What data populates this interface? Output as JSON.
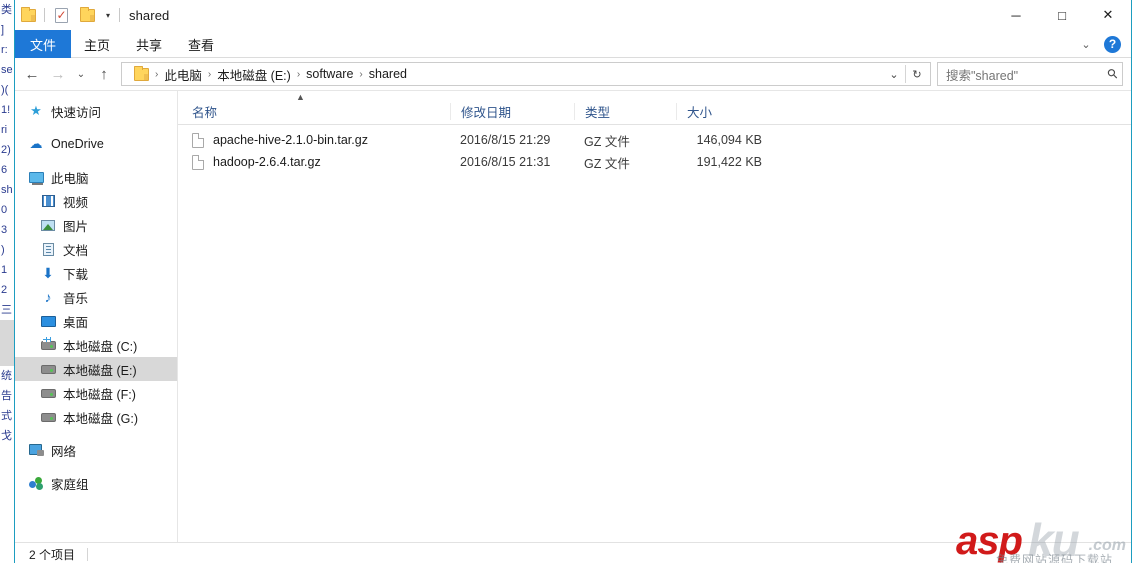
{
  "window": {
    "title": "shared",
    "quick_access": [
      {
        "name": "folder-icon",
        "label": ""
      },
      {
        "name": "properties-icon",
        "label": ""
      },
      {
        "name": "new-folder-icon",
        "label": ""
      },
      {
        "name": "customize-qat-caret",
        "label": "▾"
      }
    ],
    "controls": {
      "minimize": "─",
      "maximize": "□",
      "close": "✕"
    },
    "border_color": "#1d9dc0"
  },
  "ribbon": {
    "tabs": [
      {
        "label": "文件",
        "selected": true
      },
      {
        "label": "主页",
        "selected": false
      },
      {
        "label": "共享",
        "selected": false
      },
      {
        "label": "查看",
        "selected": false
      }
    ],
    "expand_caret": "⌄",
    "help_label": "?",
    "accent_color": "#1e78d7"
  },
  "addressbar": {
    "back": "←",
    "forward": "→",
    "recent": "⌄",
    "up": "↑",
    "breadcrumbs": [
      {
        "label": "此电脑"
      },
      {
        "label": "本地磁盘 (E:)"
      },
      {
        "label": "software"
      },
      {
        "label": "shared"
      }
    ],
    "separator": "›",
    "history_caret": "⌄",
    "refresh": "↻",
    "search": {
      "placeholder": "搜索\"shared\"",
      "value": "",
      "icon": "⚲"
    }
  },
  "sidebar": {
    "items": [
      {
        "label": "快速访问",
        "icon": "star-icon",
        "level": 0,
        "selected": false
      },
      {
        "label": "OneDrive",
        "icon": "cloud-icon",
        "level": 0,
        "selected": false
      },
      {
        "label": "此电脑",
        "icon": "computer-icon",
        "level": 0,
        "selected": false
      },
      {
        "label": "视频",
        "icon": "video-icon",
        "level": 1,
        "selected": false
      },
      {
        "label": "图片",
        "icon": "pictures-icon",
        "level": 1,
        "selected": false
      },
      {
        "label": "文档",
        "icon": "documents-icon",
        "level": 1,
        "selected": false
      },
      {
        "label": "下载",
        "icon": "downloads-icon",
        "level": 1,
        "selected": false
      },
      {
        "label": "音乐",
        "icon": "music-icon",
        "level": 1,
        "selected": false
      },
      {
        "label": "桌面",
        "icon": "desktop-icon",
        "level": 1,
        "selected": false
      },
      {
        "label": "本地磁盘 (C:)",
        "icon": "system-disk-icon",
        "level": 1,
        "selected": false
      },
      {
        "label": "本地磁盘 (E:)",
        "icon": "disk-icon",
        "level": 1,
        "selected": true
      },
      {
        "label": "本地磁盘 (F:)",
        "icon": "disk-icon",
        "level": 1,
        "selected": false
      },
      {
        "label": "本地磁盘 (G:)",
        "icon": "disk-icon",
        "level": 1,
        "selected": false
      },
      {
        "label": "网络",
        "icon": "network-icon",
        "level": 0,
        "selected": false
      },
      {
        "label": "家庭组",
        "icon": "homegroup-icon",
        "level": 0,
        "selected": false
      }
    ]
  },
  "filelist": {
    "sort_caret": "▲",
    "columns": [
      {
        "key": "name",
        "label": "名称"
      },
      {
        "key": "date",
        "label": "修改日期"
      },
      {
        "key": "type",
        "label": "类型"
      },
      {
        "key": "size",
        "label": "大小"
      }
    ],
    "rows": [
      {
        "name": "apache-hive-2.1.0-bin.tar.gz",
        "date": "2016/8/15 21:29",
        "type": "GZ 文件",
        "size": "146,094 KB"
      },
      {
        "name": "hadoop-2.6.4.tar.gz",
        "date": "2016/8/15 21:31",
        "type": "GZ 文件",
        "size": "191,422 KB"
      }
    ]
  },
  "statusbar": {
    "item_count": "2 个项目"
  },
  "watermark": {
    "brand_red": "asp",
    "brand_grey": "ku",
    "domain": ".com",
    "subtitle": "免费网站源码下载站"
  },
  "background_window": {
    "fragments": [
      "类",
      "]",
      "r:",
      "se",
      ")(",
      "1!",
      "ri",
      "2)",
      "6",
      "sh",
      "0",
      "3",
      ")",
      "1",
      "2",
      "三",
      "统",
      "告",
      "式",
      "戈"
    ]
  }
}
